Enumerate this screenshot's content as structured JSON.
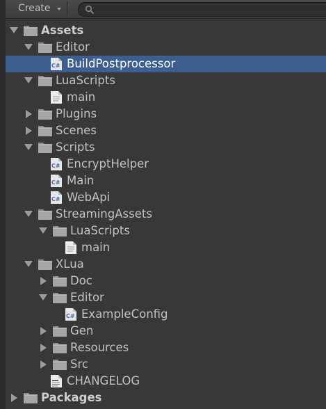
{
  "toolbar": {
    "create_label": "Create",
    "search_placeholder": ""
  },
  "tree": [
    {
      "label": "Assets",
      "type": "folder",
      "depth": 0,
      "state": "open",
      "root": true
    },
    {
      "label": "Editor",
      "type": "folder",
      "depth": 1,
      "state": "open"
    },
    {
      "label": "BuildPostprocessor",
      "type": "script",
      "depth": 2,
      "selected": true
    },
    {
      "label": "LuaScripts",
      "type": "folder",
      "depth": 1,
      "state": "open"
    },
    {
      "label": "main",
      "type": "file",
      "depth": 2
    },
    {
      "label": "Plugins",
      "type": "folder",
      "depth": 1,
      "state": "closed"
    },
    {
      "label": "Scenes",
      "type": "folder",
      "depth": 1,
      "state": "closed"
    },
    {
      "label": "Scripts",
      "type": "folder",
      "depth": 1,
      "state": "open"
    },
    {
      "label": "EncryptHelper",
      "type": "script",
      "depth": 2
    },
    {
      "label": "Main",
      "type": "script",
      "depth": 2
    },
    {
      "label": "WebApi",
      "type": "script",
      "depth": 2
    },
    {
      "label": "StreamingAssets",
      "type": "folder",
      "depth": 1,
      "state": "open"
    },
    {
      "label": "LuaScripts",
      "type": "folder",
      "depth": 2,
      "state": "open"
    },
    {
      "label": "main",
      "type": "file",
      "depth": 3
    },
    {
      "label": "XLua",
      "type": "folder",
      "depth": 1,
      "state": "open"
    },
    {
      "label": "Doc",
      "type": "folder",
      "depth": 2,
      "state": "closed"
    },
    {
      "label": "Editor",
      "type": "folder",
      "depth": 2,
      "state": "open"
    },
    {
      "label": "ExampleConfig",
      "type": "script",
      "depth": 3
    },
    {
      "label": "Gen",
      "type": "folder",
      "depth": 2,
      "state": "closed"
    },
    {
      "label": "Resources",
      "type": "folder",
      "depth": 2,
      "state": "closed"
    },
    {
      "label": "Src",
      "type": "folder",
      "depth": 2,
      "state": "closed"
    },
    {
      "label": "CHANGELOG",
      "type": "document",
      "depth": 2
    },
    {
      "label": "Packages",
      "type": "folder",
      "depth": 0,
      "state": "closed",
      "root": true
    }
  ],
  "colors": {
    "background": "#383838",
    "selection": "#3d5f8f",
    "text": "#c2c2c2"
  }
}
